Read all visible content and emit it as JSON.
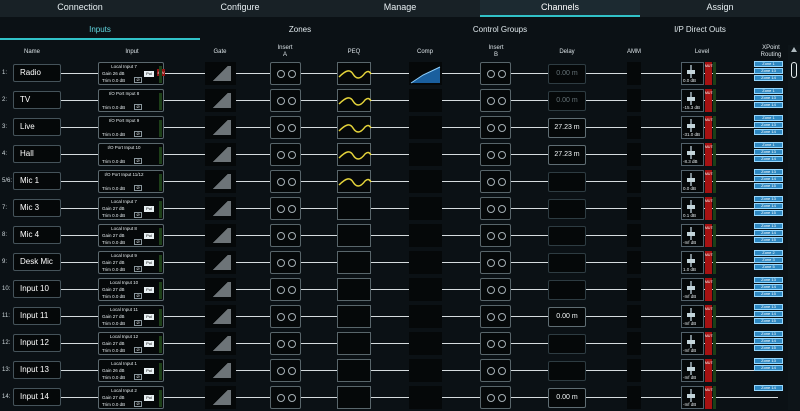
{
  "topnav": [
    {
      "label": "Connection",
      "active": false
    },
    {
      "label": "Configure",
      "active": false
    },
    {
      "label": "Manage",
      "active": false
    },
    {
      "label": "Channels",
      "active": true
    },
    {
      "label": "Assign",
      "active": false
    }
  ],
  "subnav": [
    {
      "label": "Inputs",
      "active": true
    },
    {
      "label": "Zones",
      "active": false
    },
    {
      "label": "Control Groups",
      "active": false
    },
    {
      "label": "I/P Direct Outs",
      "active": false
    }
  ],
  "headers": {
    "name": "Name",
    "input": "Input",
    "gate": "Gate",
    "insertA": "Insert A",
    "peq": "PEQ",
    "comp": "Comp",
    "insertB": "Insert B",
    "delay": "Delay",
    "amm": "AMM",
    "level": "Level",
    "xpoint": "XPoint Routing"
  },
  "rows": [
    {
      "num": "1:",
      "name": "Radio",
      "input": "Local Input 7",
      "gain": "Gain 26 dB",
      "trim": "Trim 0.0 dB",
      "phantom": true,
      "delay": "0.00 m",
      "delay_active": false,
      "level": "0.0 dB",
      "routing": [
        "Zone 1",
        "Zone 13",
        "Zone 14"
      ],
      "peq": true,
      "comp": true
    },
    {
      "num": "2:",
      "name": "TV",
      "input": "I/O Port Input 8",
      "gain": "",
      "trim": "Trim 0.0 dB",
      "phantom": false,
      "delay": "0.00 m",
      "delay_active": false,
      "level": "-15.3 dB",
      "routing": [
        "Zone 1",
        "Zone 13",
        "Zone 14"
      ],
      "peq": true,
      "comp": false
    },
    {
      "num": "3:",
      "name": "Live",
      "input": "I/O Port Input 9",
      "gain": "",
      "trim": "Trim 0.0 dB",
      "phantom": false,
      "delay": "27.23 m",
      "delay_active": true,
      "level": "-31.0 dB",
      "routing": [
        "Zone 1",
        "Zone 13",
        "Zone 14"
      ],
      "peq": true,
      "comp": false
    },
    {
      "num": "4:",
      "name": "Hall",
      "input": "I/O Port Input 10",
      "gain": "",
      "trim": "Trim 0.0 dB",
      "phantom": false,
      "delay": "27.23 m",
      "delay_active": true,
      "level": "-8.3 dB",
      "routing": [
        "Zone 1",
        "Zone 13",
        "Zone 14"
      ],
      "peq": true,
      "comp": false
    },
    {
      "num": "5/6:",
      "name": "Mic 1",
      "input": "I/O Port Input 11/12",
      "gain": "",
      "trim": "Trim 0.0 dB",
      "phantom": false,
      "delay": "",
      "delay_active": false,
      "level": "0.0 dB",
      "routing": [
        "Zone 13",
        "Zone 14",
        "Zone 15"
      ],
      "peq": true,
      "comp": false
    },
    {
      "num": "7:",
      "name": "Mic 3",
      "input": "Local Input 7",
      "gain": "Gain 27 dB",
      "trim": "Trim 0.0 dB",
      "phantom": false,
      "delay": "",
      "delay_active": false,
      "level": "0.1 dB",
      "routing": [
        "Zone 13",
        "Zone 14",
        "Zone 15"
      ],
      "peq": false,
      "comp": false
    },
    {
      "num": "8:",
      "name": "Mic 4",
      "input": "Local Input 8",
      "gain": "Gain 27 dB",
      "trim": "Trim 0.0 dB",
      "phantom": false,
      "delay": "",
      "delay_active": false,
      "level": "-Inf dB",
      "routing": [
        "Zone 13",
        "Zone 14",
        "Zone 15"
      ],
      "peq": false,
      "comp": false
    },
    {
      "num": "9:",
      "name": "Desk Mic",
      "input": "Local Input 9",
      "gain": "Gain 27 dB",
      "trim": "Trim 0.0 dB",
      "phantom": false,
      "delay": "",
      "delay_active": false,
      "level": "1.0 dB",
      "routing": [
        "Zone 2",
        "Zone 3",
        "Zone 5"
      ],
      "peq": false,
      "comp": false
    },
    {
      "num": "10:",
      "name": "Input 10",
      "input": "Local Input 10",
      "gain": "Gain 27 dB",
      "trim": "Trim 0.0 dB",
      "phantom": false,
      "delay": "",
      "delay_active": false,
      "level": "-Inf dB",
      "routing": [
        "Zone 13",
        "Zone 14",
        "Zone 15"
      ],
      "peq": false,
      "comp": false
    },
    {
      "num": "11:",
      "name": "Input 11",
      "input": "Local Input 11",
      "gain": "Gain 27 dB",
      "trim": "Trim 0.0 dB",
      "phantom": false,
      "delay": "0.00 m",
      "delay_active": true,
      "level": "-Inf dB",
      "routing": [
        "Zone 13",
        "Zone 14",
        "Zone 15"
      ],
      "peq": false,
      "comp": false
    },
    {
      "num": "12:",
      "name": "Input 12",
      "input": "Local Input 12",
      "gain": "Gain 27 dB",
      "trim": "Trim 0.0 dB",
      "phantom": false,
      "delay": "",
      "delay_active": false,
      "level": "-Inf dB",
      "routing": [
        "Zone 13",
        "Zone 14",
        "Zone 15"
      ],
      "peq": false,
      "comp": false
    },
    {
      "num": "13:",
      "name": "Input 13",
      "input": "Local Input 1",
      "gain": "Gain 26 dB",
      "trim": "Trim 0.0 dB",
      "phantom": false,
      "delay": "",
      "delay_active": false,
      "level": "-Inf dB",
      "routing": [
        "Zone 13",
        "Zone 14"
      ],
      "peq": false,
      "comp": false
    },
    {
      "num": "14:",
      "name": "Input 14",
      "input": "Local Input 2",
      "gain": "Gain 27 dB",
      "trim": "Trim 0.0 dB",
      "phantom": false,
      "delay": "0.00 m",
      "delay_active": true,
      "level": "-Inf dB",
      "routing": [
        "Zone 14"
      ],
      "peq": false,
      "comp": false
    }
  ]
}
